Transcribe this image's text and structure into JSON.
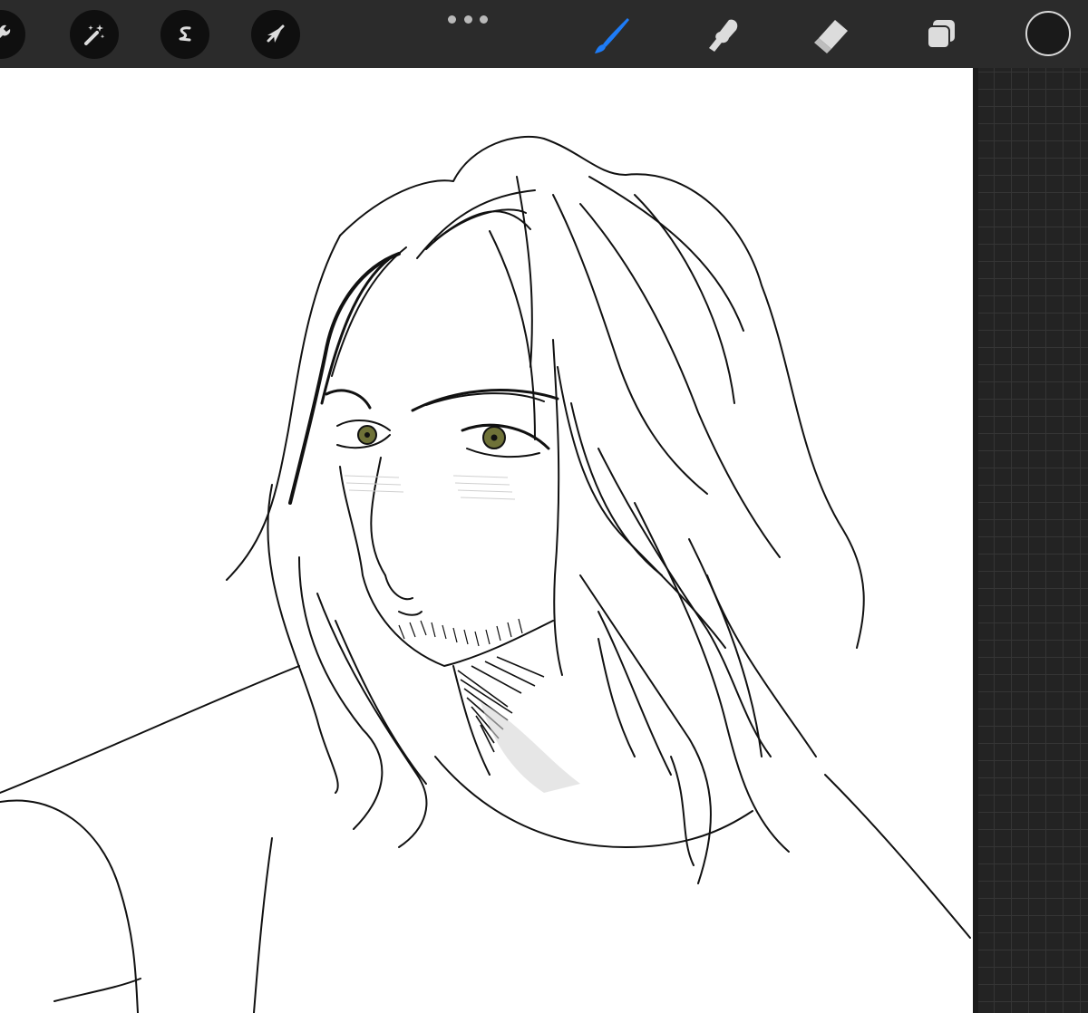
{
  "toolbar": {
    "left_tools": [
      {
        "id": "actions",
        "icon": "wrench-icon"
      },
      {
        "id": "adjustments",
        "icon": "magic-wand-icon"
      },
      {
        "id": "selection",
        "icon": "selection-s-icon"
      },
      {
        "id": "transform",
        "icon": "arrow-cursor-icon"
      }
    ],
    "more_icon": "more-dots-icon",
    "right_tools": [
      {
        "id": "brush",
        "icon": "brush-icon",
        "active": true
      },
      {
        "id": "smudge",
        "icon": "smudge-finger-icon",
        "active": false
      },
      {
        "id": "eraser",
        "icon": "eraser-icon",
        "active": false
      },
      {
        "id": "layers",
        "icon": "layers-icon",
        "active": false
      }
    ],
    "active_color": "#1a1a1a",
    "accent_color": "#1e7cf7"
  },
  "canvas": {
    "content": "line-art-sketch",
    "background": "#ffffff",
    "eye_color": "#6f7238"
  },
  "side_panel": {
    "pattern": "grid",
    "background": "#232323"
  }
}
